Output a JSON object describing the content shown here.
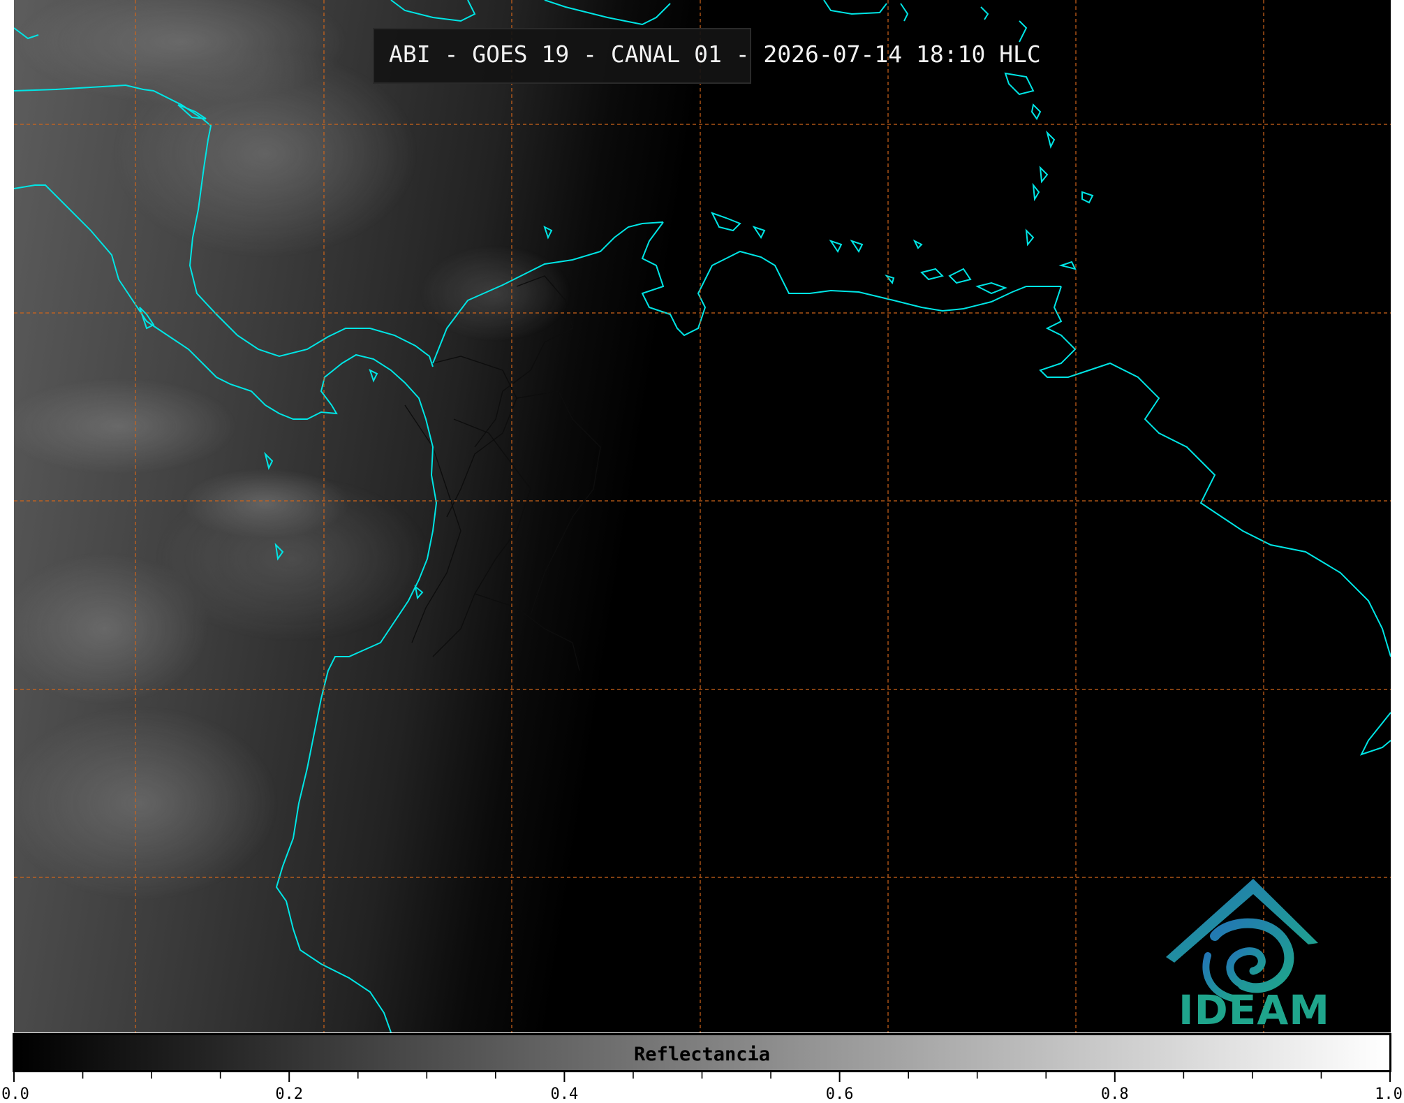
{
  "title": "ABI - GOES 19 - CANAL 01 - 2026-07-14 18:10 HLC",
  "logo": {
    "text": "IDEAM"
  },
  "colorbar": {
    "label": "Reflectancia",
    "min": 0.0,
    "max": 1.0,
    "tick_labels": [
      "0.0",
      "0.2",
      "0.4",
      "0.6",
      "0.8",
      "1.0"
    ],
    "minor_ticks": 20
  },
  "colors": {
    "coastline": "#00e5e5",
    "grid": "#d0651a",
    "night_side": "#000000",
    "borders": "#111111",
    "logo_blue": "#2276b5",
    "logo_green": "#1fa58c"
  },
  "grid": {
    "style": "dashed",
    "columns": 7,
    "rows": 5
  }
}
